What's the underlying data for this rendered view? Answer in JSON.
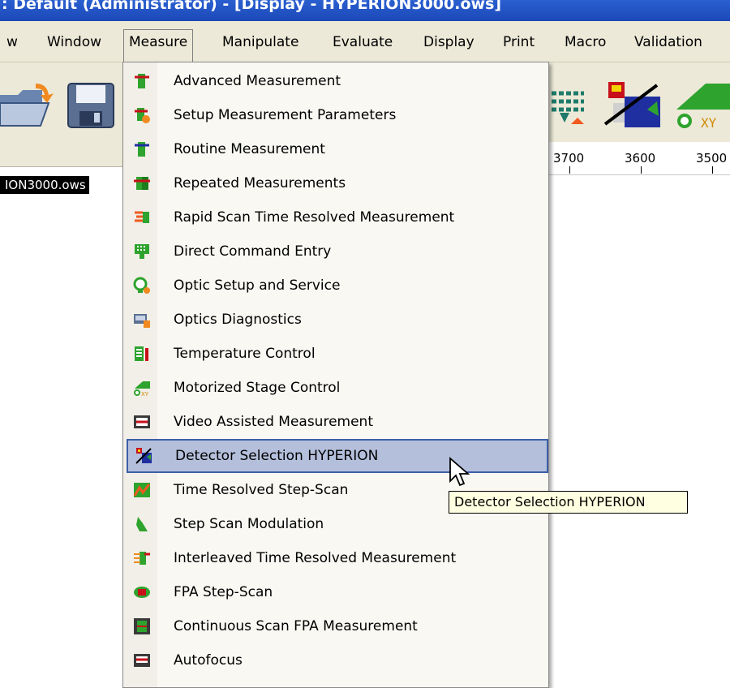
{
  "window": {
    "title": ": Default  (Administrator) - [Display - HYPERION3000.ows]"
  },
  "menubar": {
    "items": [
      "w",
      "Window",
      "Measure",
      "Manipulate",
      "Evaluate",
      "Display",
      "Print",
      "Macro",
      "Validation"
    ],
    "active": "Measure"
  },
  "file_tab": {
    "label": "ION3000.ows"
  },
  "ruler": {
    "ticks": [
      "3700",
      "3600",
      "3500"
    ]
  },
  "measure_menu": {
    "items": [
      {
        "label": "Advanced Measurement",
        "icon": "advanced-measurement-icon"
      },
      {
        "label": "Setup Measurement Parameters",
        "icon": "setup-parameters-icon"
      },
      {
        "label": "Routine Measurement",
        "icon": "routine-measurement-icon"
      },
      {
        "label": "Repeated Measurements",
        "icon": "repeated-measurements-icon"
      },
      {
        "label": "Rapid Scan Time Resolved Measurement",
        "icon": "rapid-scan-icon"
      },
      {
        "label": "Direct Command Entry",
        "icon": "command-entry-icon"
      },
      {
        "label": "Optic Setup and Service",
        "icon": "optic-setup-icon"
      },
      {
        "label": "Optics Diagnostics",
        "icon": "optics-diagnostics-icon"
      },
      {
        "label": "Temperature Control",
        "icon": "temperature-control-icon"
      },
      {
        "label": "Motorized Stage Control",
        "icon": "motorized-stage-icon"
      },
      {
        "label": "Video Assisted Measurement",
        "icon": "video-measurement-icon"
      },
      {
        "label": "Detector Selection HYPERION",
        "icon": "detector-selection-icon"
      },
      {
        "label": "Time Resolved Step-Scan",
        "icon": "time-resolved-step-scan-icon"
      },
      {
        "label": "Step Scan Modulation",
        "icon": "step-scan-modulation-icon"
      },
      {
        "label": "Interleaved Time Resolved Measurement",
        "icon": "interleaved-measurement-icon"
      },
      {
        "label": "FPA Step-Scan",
        "icon": "fpa-step-scan-icon"
      },
      {
        "label": "Continuous Scan FPA Measurement",
        "icon": "continuous-scan-fpa-icon"
      },
      {
        "label": "Autofocus",
        "icon": "autofocus-icon"
      }
    ],
    "highlighted": "Detector Selection HYPERION"
  },
  "tooltip": {
    "text": "Detector Selection HYPERION"
  }
}
